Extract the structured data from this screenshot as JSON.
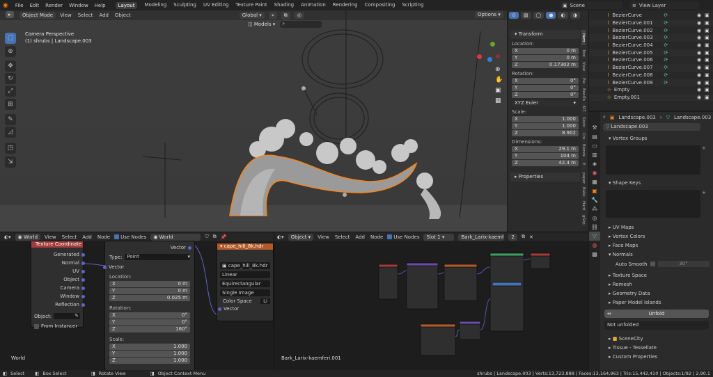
{
  "menu": [
    "File",
    "Edit",
    "Render",
    "Window",
    "Help"
  ],
  "workspaces": [
    "Layout",
    "Modeling",
    "Sculpting",
    "UV Editing",
    "Texture Paint",
    "Shading",
    "Animation",
    "Rendering",
    "Compositing",
    "Scripting"
  ],
  "active_workspace": "Layout",
  "scene_name": "Scene",
  "view_layer": "View Layer",
  "viewport": {
    "mode": "Object Mode",
    "menus": [
      "View",
      "Select",
      "Add",
      "Object"
    ],
    "orientation": "Global",
    "options": "Options",
    "camera_label": "Camera Perspective",
    "object_label": "(1) shrubs | Landscape.003",
    "collection_dropdown": "Models",
    "side_tabs": [
      "Item",
      "Tool",
      "View",
      "Pie",
      "BoolTool",
      "KIT",
      "Sketc",
      "Cre",
      "Blender",
      "E",
      "paper",
      "Bake",
      "Hard",
      "gSkp"
    ]
  },
  "transform": {
    "title": "Transform",
    "location_label": "Location:",
    "location": [
      {
        "axis": "X",
        "value": "0 m"
      },
      {
        "axis": "Y",
        "value": "0 m"
      },
      {
        "axis": "Z",
        "value": "0.17302 m"
      }
    ],
    "rotation_label": "Rotation:",
    "rotation": [
      {
        "axis": "X",
        "value": "0°"
      },
      {
        "axis": "Y",
        "value": "0°"
      },
      {
        "axis": "Z",
        "value": "0°"
      }
    ],
    "rotation_mode": "XYZ Euler",
    "scale_label": "Scale:",
    "scale": [
      {
        "axis": "X",
        "value": "1.000"
      },
      {
        "axis": "Y",
        "value": "1.000"
      },
      {
        "axis": "Z",
        "value": "8.902"
      }
    ],
    "dimensions_label": "Dimensions:",
    "dimensions": [
      {
        "axis": "X",
        "value": "29.1 m"
      },
      {
        "axis": "Y",
        "value": "104 m"
      },
      {
        "axis": "Z",
        "value": "42.4 m"
      }
    ],
    "properties": "Properties"
  },
  "outliner": [
    "BezierCurve",
    "BezierCurve.001",
    "BezierCurve.002",
    "BezierCurve.003",
    "BezierCurve.004",
    "BezierCurve.005",
    "BezierCurve.006",
    "BezierCurve.007",
    "BezierCurve.008",
    "BezierCurve.009",
    "Empty",
    "Empty.001"
  ],
  "properties_editor": {
    "breadcrumb_obj": "Landscape.003",
    "breadcrumb_data": "Landscape.003",
    "mesh_name": "Landscape.003",
    "vertex_groups": "Vertex Groups",
    "shape_keys": "Shape Keys",
    "sections": [
      "UV Maps",
      "Vertex Colors",
      "Face Maps",
      "Normals"
    ],
    "auto_smooth": "Auto Smooth",
    "auto_smooth_angle": "30°",
    "sections2": [
      "Texture Space",
      "Remesh",
      "Geometry Data",
      "Paper Model Islands"
    ],
    "unfold_button": "Unfold",
    "unfold_status": "Not unfolded",
    "scenecity": "SceneCity",
    "tissue": "Tissue - Tessellate",
    "custom_props": "Custom Properties"
  },
  "world_editor": {
    "shader_type": "World",
    "menus": [
      "View",
      "Select",
      "Add",
      "Node"
    ],
    "use_nodes": "Use Nodes",
    "world_name": "World",
    "footer_label": "World",
    "tex_coord": {
      "title": "Texture Coordinate",
      "outputs": [
        "Generated",
        "Normal",
        "UV",
        "Object",
        "Camera",
        "Window",
        "Reflection"
      ],
      "object_label": "Object:",
      "from_instancer": "From Instancer"
    },
    "mapping": {
      "output": "Vector",
      "type_label": "Type:",
      "type_value": "Point",
      "vector": "Vector",
      "location_label": "Location:",
      "location": [
        {
          "axis": "X",
          "value": "0 m"
        },
        {
          "axis": "Y",
          "value": "0 m"
        },
        {
          "axis": "Z",
          "value": "0.025 m"
        }
      ],
      "rotation_label": "Rotation:",
      "rotation": [
        {
          "axis": "X",
          "value": "0°"
        },
        {
          "axis": "Y",
          "value": "0°"
        },
        {
          "axis": "Z",
          "value": "160°"
        }
      ],
      "scale_label": "Scale:",
      "scale": [
        {
          "axis": "X",
          "value": "1.000"
        },
        {
          "axis": "Y",
          "value": "1.000"
        },
        {
          "axis": "Z",
          "value": "1.000"
        }
      ]
    },
    "env_tex": {
      "title": "cape_hill_8k.hdr",
      "image": "cape_hill_8k.hdr",
      "interp": "Linear",
      "proj": "Equirectangular",
      "ext": "Single Image",
      "colorspace_label": "Color Space",
      "colorspace_value": "Li",
      "vector": "Vector"
    }
  },
  "object_editor": {
    "shader_type": "Object",
    "menus": [
      "View",
      "Select",
      "Add",
      "Node"
    ],
    "use_nodes": "Use Nodes",
    "slot": "Slot 1",
    "material": "Bark_Larix-kaemferi",
    "users": "2",
    "footer_label": "Bark_Larix-kaemferi.001"
  },
  "status": {
    "select": "Select",
    "box_select": "Box Select",
    "rotate": "Rotate View",
    "context_menu": "Object Context Menu",
    "stats": "shrubs | Landscape.003 | Verts:13,723,888 | Faces:13,164,963 | Tris:15,442,410 | Objects:1/82 | 2.90.1"
  },
  "colors": {
    "accent": "#4772b3",
    "selection": "#f2861f",
    "node_socket": "#6363c7",
    "texture_header": "#e8803a"
  }
}
